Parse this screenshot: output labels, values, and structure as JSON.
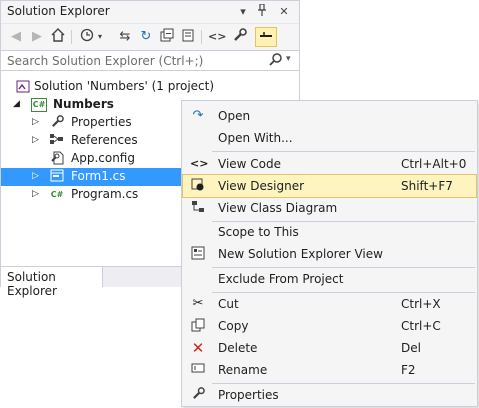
{
  "panel": {
    "title": "Solution Explorer",
    "title_buttons": [
      "▾",
      "ᵽ",
      "✕"
    ],
    "search_placeholder": "Search Solution Explorer (Ctrl+;)",
    "bottom_tab": "Solution Explorer"
  },
  "tree": [
    {
      "label": "Solution 'Numbers' (1 project)",
      "icon": "solution-icon",
      "bold": false
    },
    {
      "label": "Numbers",
      "icon": "csharp-project-icon",
      "bold": true
    },
    {
      "label": "Properties",
      "icon": "wrench-icon",
      "bold": false
    },
    {
      "label": "References",
      "icon": "references-icon",
      "bold": false
    },
    {
      "label": "App.config",
      "icon": "config-file-icon",
      "bold": false
    },
    {
      "label": "Form1.cs",
      "icon": "form-icon",
      "bold": false,
      "selected": true
    },
    {
      "label": "Program.cs",
      "icon": "csharp-file-icon",
      "bold": false
    }
  ],
  "menu": {
    "items": [
      {
        "label": "Open",
        "shortcut": "",
        "icon": "open-arrow-icon"
      },
      {
        "label": "Open With...",
        "shortcut": "",
        "icon": ""
      },
      {
        "label": "View Code",
        "shortcut": "Ctrl+Alt+0",
        "icon": "code-icon"
      },
      {
        "label": "View Designer",
        "shortcut": "Shift+F7",
        "icon": "designer-icon",
        "highlighted": true
      },
      {
        "label": "View Class Diagram",
        "shortcut": "",
        "icon": "class-diagram-icon"
      },
      {
        "label": "Scope to This",
        "shortcut": "",
        "icon": ""
      },
      {
        "label": "New Solution Explorer View",
        "shortcut": "",
        "icon": "new-view-icon"
      },
      {
        "label": "Exclude From Project",
        "shortcut": "",
        "icon": ""
      },
      {
        "label": "Cut",
        "shortcut": "Ctrl+X",
        "icon": "scissors-icon"
      },
      {
        "label": "Copy",
        "shortcut": "Ctrl+C",
        "icon": "copy-icon"
      },
      {
        "label": "Delete",
        "shortcut": "Del",
        "icon": "delete-x-icon"
      },
      {
        "label": "Rename",
        "shortcut": "F2",
        "icon": "rename-icon"
      },
      {
        "label": "Properties",
        "shortcut": "",
        "icon": "wrench-icon"
      }
    ]
  },
  "colors": {
    "selection": "#3399ff",
    "menu_highlight": "#fdf4bf",
    "delete_red": "#c42b1c",
    "open_blue": "#1e6fc0"
  }
}
